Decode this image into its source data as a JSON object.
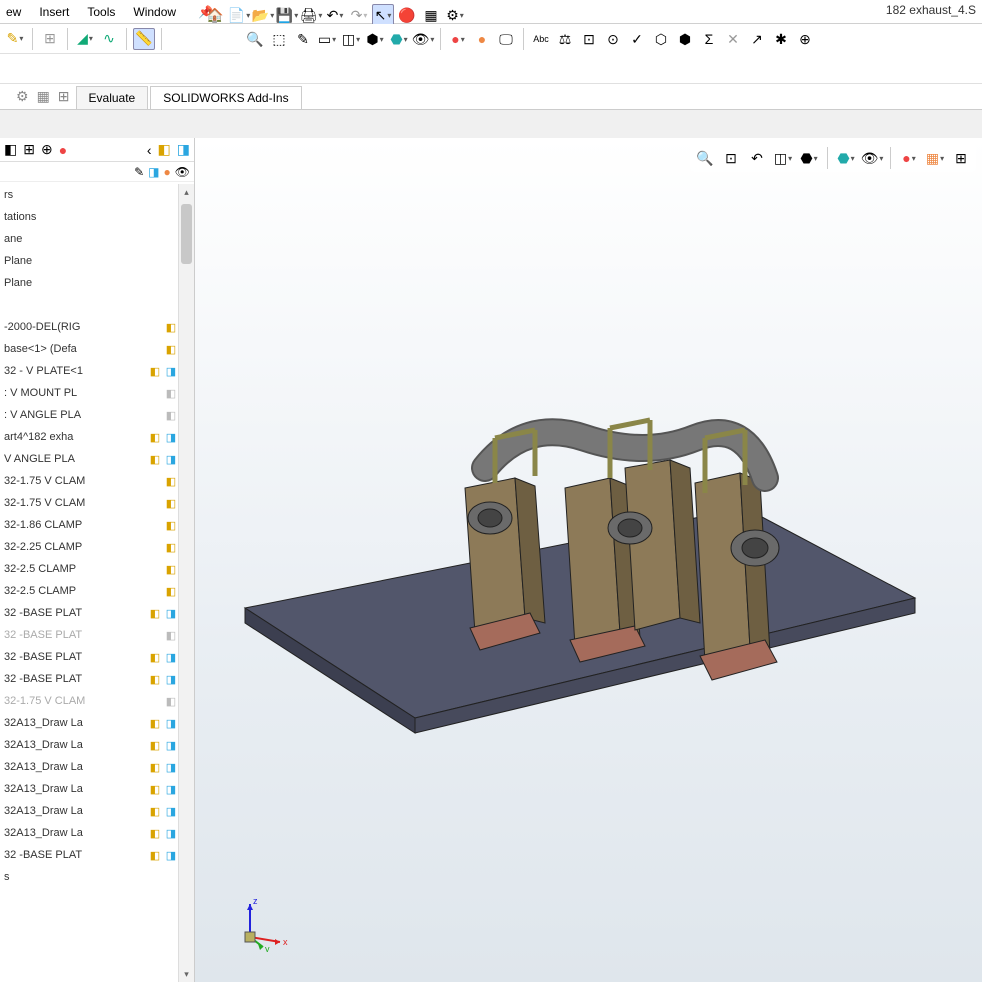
{
  "filename": "182 exhaust_4.S",
  "menu": {
    "m0": "ew",
    "m1": "Insert",
    "m2": "Tools",
    "m3": "Window"
  },
  "cmdtabs": {
    "evaluate": "Evaluate",
    "addins": "SOLIDWORKS Add-Ins"
  },
  "tree": {
    "items": [
      {
        "label": "rs",
        "icons": []
      },
      {
        "label": "tations",
        "icons": []
      },
      {
        "label": "ane",
        "icons": [
          "plane"
        ]
      },
      {
        "label": "Plane",
        "icons": [
          "plane"
        ]
      },
      {
        "label": "Plane",
        "icons": [
          "plane"
        ]
      },
      {
        "label": "",
        "icons": [
          "origin"
        ]
      },
      {
        "label": "-2000-DEL(RIG",
        "icons": [
          "cube",
          "bluecube"
        ]
      },
      {
        "label": "base<1> (Defa",
        "icons": [
          "cube",
          "bluecube"
        ]
      },
      {
        "label": "32 - V PLATE<1",
        "icons": [
          "cube",
          "bluecube",
          "tri"
        ]
      },
      {
        "label": ": V MOUNT PL",
        "icons": [
          "grey",
          "bluecube"
        ]
      },
      {
        "label": ": V ANGLE PLA",
        "icons": [
          "grey",
          "bluecube"
        ]
      },
      {
        "label": "art4^182 exha",
        "icons": [
          "cube",
          "bluecube",
          "tri"
        ]
      },
      {
        "label": "V ANGLE PLA",
        "icons": [
          "cube",
          "bluecube",
          "tri"
        ]
      },
      {
        "label": "32-1.75 V CLAM",
        "icons": [
          "cube",
          "bluecube"
        ]
      },
      {
        "label": "32-1.75 V CLAM",
        "icons": [
          "cube",
          "bluecube"
        ]
      },
      {
        "label": "32-1.86 CLAMP",
        "icons": [
          "cube",
          "bluecube"
        ]
      },
      {
        "label": "32-2.25 CLAMP",
        "icons": [
          "cube",
          "bluecube"
        ]
      },
      {
        "label": "32-2.5 CLAMP",
        "icons": [
          "cube",
          "bluecube"
        ]
      },
      {
        "label": "32-2.5 CLAMP",
        "icons": [
          "cube",
          "bluecube"
        ]
      },
      {
        "label": "32 -BASE PLAT",
        "icons": [
          "cube",
          "bluecube",
          "tri"
        ]
      },
      {
        "label": "32 -BASE PLAT",
        "icons": [
          "grey",
          "bluecube"
        ],
        "dim": true
      },
      {
        "label": "32 -BASE PLAT",
        "icons": [
          "cube",
          "bluecube",
          "tri"
        ]
      },
      {
        "label": "32 -BASE PLAT",
        "icons": [
          "cube",
          "bluecube",
          "tri"
        ]
      },
      {
        "label": "32-1.75 V CLAM",
        "icons": [
          "grey",
          "bluecube"
        ],
        "dim": true
      },
      {
        "label": "32A13_Draw La",
        "icons": [
          "cube",
          "bluecube",
          "tri"
        ]
      },
      {
        "label": "32A13_Draw La",
        "icons": [
          "cube",
          "bluecube",
          "tri"
        ]
      },
      {
        "label": "32A13_Draw La",
        "icons": [
          "cube",
          "bluecube",
          "tri"
        ]
      },
      {
        "label": "32A13_Draw La",
        "icons": [
          "cube",
          "bluecube",
          "tri"
        ]
      },
      {
        "label": "32A13_Draw La",
        "icons": [
          "cube",
          "bluecube",
          "tri"
        ]
      },
      {
        "label": "32A13_Draw La",
        "icons": [
          "cube",
          "bluecube",
          "tri"
        ]
      },
      {
        "label": "32 -BASE PLAT",
        "icons": [
          "cube",
          "bluecube",
          "tri"
        ]
      },
      {
        "label": "s",
        "icons": []
      }
    ]
  },
  "triad": {
    "x": "x",
    "y": "y",
    "z": "z"
  }
}
